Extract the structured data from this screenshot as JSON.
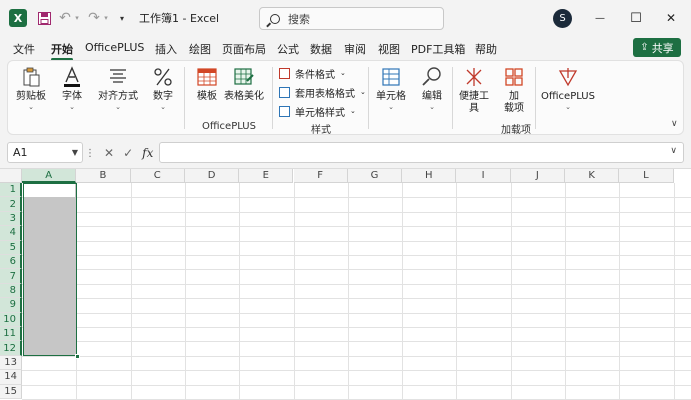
{
  "titlebar": {
    "app_letter": "X",
    "title": "工作簿1 - Excel",
    "search_placeholder": "搜索",
    "avatar_letter": "S",
    "undo": "↶",
    "redo": "↷",
    "qat_more": "▾",
    "minimize": "—",
    "maximize": "☐",
    "close": "✕"
  },
  "menu": {
    "tabs": [
      "文件",
      "开始",
      "OfficePLUS",
      "插入",
      "绘图",
      "页面布局",
      "公式",
      "数据",
      "审阅",
      "视图",
      "PDF工具箱",
      "帮助"
    ],
    "active_tab": "开始",
    "share_label": "共享"
  },
  "ribbon": {
    "clipboard": "剪贴板",
    "font": "字体",
    "alignment": "对齐方式",
    "number": "数字",
    "template": "模板",
    "table_beautify": "表格美化",
    "officeplus_group": "OfficePLUS",
    "conditional_format": "条件格式",
    "format_as_table": "套用表格格式",
    "cell_styles": "单元格样式",
    "styles_group": "样式",
    "cells": "单元格",
    "editing": "编辑",
    "convenience_line1": "便捷工",
    "convenience_line2": "具",
    "addins_line1": "加",
    "addins_line2": "载项",
    "addins_group": "加载项",
    "officeplus": "OfficePLUS"
  },
  "formula_bar": {
    "name_box": "A1",
    "cancel": "✕",
    "enter": "✓",
    "fx": "fx",
    "formula_value": ""
  },
  "grid": {
    "columns": [
      "A",
      "B",
      "C",
      "D",
      "E",
      "F",
      "G",
      "H",
      "I",
      "J",
      "K",
      "L"
    ],
    "rows": [
      "1",
      "2",
      "3",
      "4",
      "5",
      "6",
      "7",
      "8",
      "9",
      "10",
      "11",
      "12",
      "13",
      "14",
      "15"
    ],
    "selected_column": "A",
    "selected_range": "A1:A12"
  },
  "colors": {
    "excel_green": "#1d6f42",
    "selection_fill": "#c6c6c6"
  }
}
